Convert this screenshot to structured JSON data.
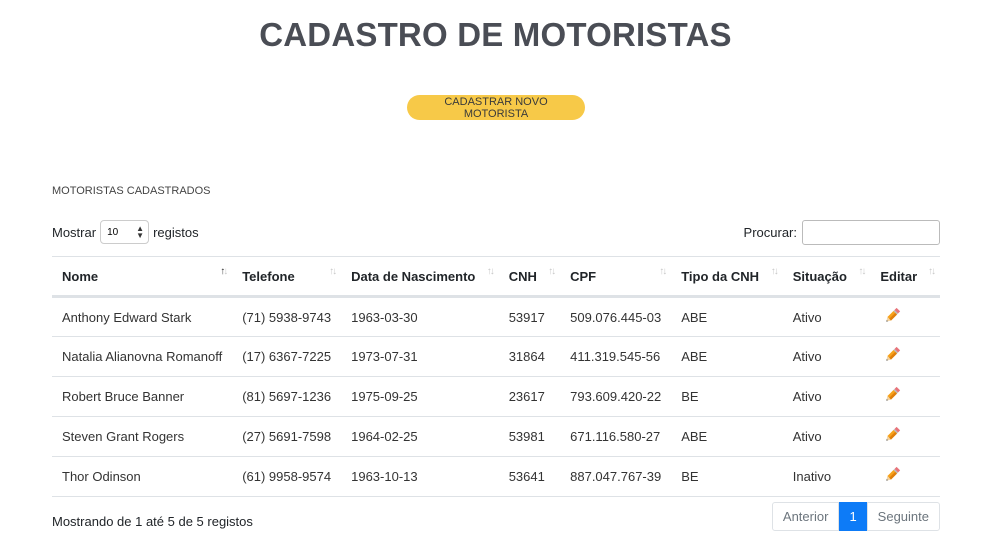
{
  "title": "CADASTRO DE MOTORISTAS",
  "cta_label": "CADASTRAR NOVO MOTORISTA",
  "section_label": "MOTORISTAS CADASTRADOS",
  "length": {
    "prefix": "Mostrar",
    "value": "10",
    "suffix": "registos"
  },
  "search": {
    "label": "Procurar:"
  },
  "table": {
    "columns": [
      "Nome",
      "Telefone",
      "Data de Nascimento",
      "CNH",
      "CPF",
      "Tipo da CNH",
      "Situação",
      "Editar"
    ],
    "sort_column": "Nome",
    "rows": [
      [
        "Anthony Edward Stark",
        "(71) 5938-9743",
        "1963-03-30",
        "53917",
        "509.076.445-03",
        "ABE",
        "Ativo"
      ],
      [
        "Natalia Alianovna Romanoff",
        "(17) 6367-7225",
        "1973-07-31",
        "31864",
        "411.319.545-56",
        "ABE",
        "Ativo"
      ],
      [
        "Robert Bruce Banner",
        "(81) 5697-1236",
        "1975-09-25",
        "23617",
        "793.609.420-22",
        "BE",
        "Ativo"
      ],
      [
        "Steven Grant Rogers",
        "(27) 5691-7598",
        "1964-02-25",
        "53981",
        "671.116.580-27",
        "ABE",
        "Ativo"
      ],
      [
        "Thor Odinson",
        "(61) 9958-9574",
        "1963-10-13",
        "53641",
        "887.047.767-39",
        "BE",
        "Inativo"
      ]
    ]
  },
  "info": "Mostrando de 1 até 5 de 5 registos",
  "pagination": {
    "prev": "Anterior",
    "current": "1",
    "next": "Seguinte"
  },
  "colors": {
    "accent": "#f7c948",
    "active_page": "#0d7bf7",
    "title": "#4a4d55"
  }
}
